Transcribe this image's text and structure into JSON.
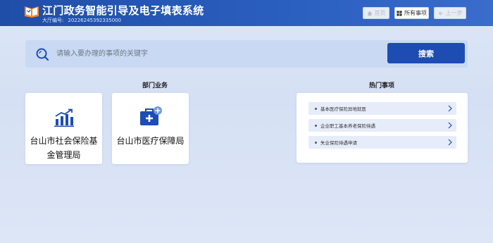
{
  "header": {
    "title": "江门政务智能引导及电子填表系统",
    "hall_label": "大厅编号:",
    "hall_number": "20226245392335000",
    "buttons": {
      "home": "首页",
      "all_items": "所有事项",
      "back": "上一步"
    }
  },
  "search": {
    "placeholder": "请输入要办理的事项的关键字",
    "button": "搜索"
  },
  "departments": {
    "title": "部门业务",
    "items": [
      {
        "name": "台山市社会保险基金管理局",
        "icon": "bar-chart-growth-icon"
      },
      {
        "name": "台山市医疗保障局",
        "icon": "medical-kit-icon"
      }
    ]
  },
  "hot": {
    "title": "热门事项",
    "items": [
      {
        "label": "基本医疗保险异地就医"
      },
      {
        "label": "企业职工基本养老保险待遇"
      },
      {
        "label": "失业保险待遇申请"
      }
    ]
  },
  "colors": {
    "header_bg": "#2456b4",
    "accent": "#1d4db2",
    "search_bar_bg": "#c9d9f3",
    "hot_item_bg": "#e7ecfa"
  }
}
